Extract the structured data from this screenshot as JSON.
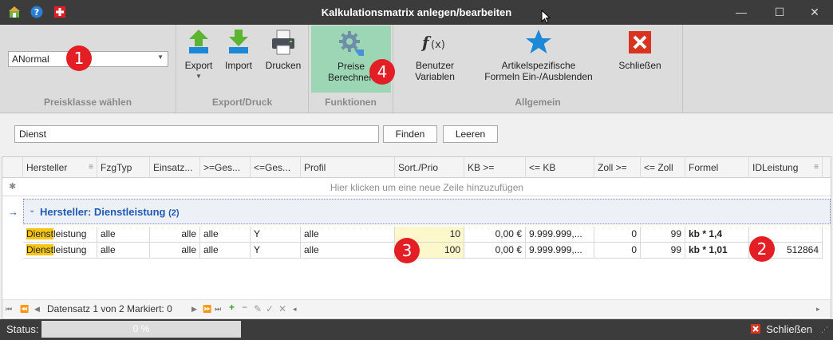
{
  "window": {
    "title": "Kalkulationsmatrix anlegen/bearbeiten",
    "minimize": "—",
    "maximize": "☐",
    "close": "✕"
  },
  "ribbon": {
    "preisklasse": {
      "selected": "ANormal",
      "group_label": "Preisklasse wählen"
    },
    "export_druck": {
      "export": "Export",
      "import": "Import",
      "drucken": "Drucken",
      "group_label": "Export/Druck"
    },
    "funktionen": {
      "preise_line1": "Preise",
      "preise_line2": "Berechnen",
      "group_label": "Funktionen"
    },
    "allgemein": {
      "benutzer_line1": "Benutzer",
      "benutzer_line2": "Variablen",
      "artikel_line1": "Artikelspezifische",
      "artikel_line2": "Formeln Ein-/Ausblenden",
      "schliessen": "Schließen",
      "group_label": "Allgemein"
    }
  },
  "search": {
    "value": "Dienst",
    "find": "Finden",
    "clear": "Leeren"
  },
  "grid": {
    "columns": [
      "Hersteller",
      "FzgTyp",
      "Einsatz...",
      ">=Ges...",
      "<=Ges...",
      "Profil",
      "Sort./Prio",
      "KB >=",
      "<= KB",
      "Zoll >=",
      "<= Zoll",
      "Formel",
      "IDLeistung"
    ],
    "new_row_text": "Hier klicken um eine neue Zeile hinzuzufügen",
    "group": {
      "label": "Hersteller: Dienstleistung",
      "count": "(2)"
    },
    "rows": [
      {
        "hersteller_hl": "Dienst",
        "hersteller_rest": "leistung",
        "fzgtyp": "alle",
        "einsatz": "alle",
        "ges_min": "alle",
        "ges_max": "Y",
        "profil": "alle",
        "prio": "10",
        "kb_min": "0,00 €",
        "kb_max": "9.999.999,...",
        "zoll_min": "0",
        "zoll_max": "99",
        "formel": "kb * 1,4",
        "id": ""
      },
      {
        "hersteller_hl": "Dienst",
        "hersteller_rest": "leistung",
        "fzgtyp": "alle",
        "einsatz": "alle",
        "ges_min": "alle",
        "ges_max": "Y",
        "profil": "alle",
        "prio": "100",
        "kb_min": "0,00 €",
        "kb_max": "9.999.999,...",
        "zoll_min": "0",
        "zoll_max": "99",
        "formel": "kb * 1,01",
        "id": "512864"
      }
    ],
    "navigator": {
      "text": "Datensatz 1 von 2 Markiert: 0"
    }
  },
  "badges": [
    "1",
    "2",
    "3",
    "4"
  ],
  "status": {
    "label": "Status:",
    "progress": "0 %",
    "close": "Schließen"
  },
  "colors": {
    "accent": "#1e5bb5",
    "badge": "#e31e24",
    "highlight": "#f5c518"
  }
}
